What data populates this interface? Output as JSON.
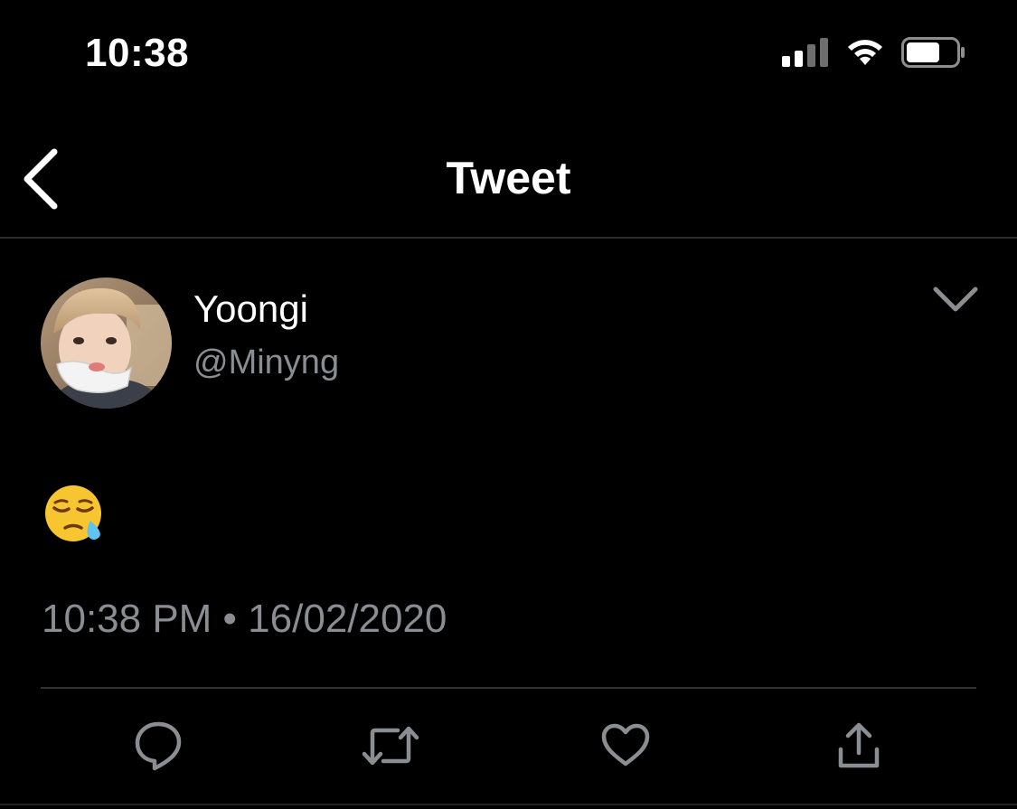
{
  "status_bar": {
    "time": "10:38",
    "icons": [
      "signal-icon",
      "wifi-icon",
      "battery-icon"
    ]
  },
  "nav": {
    "back_icon": "chevron-left-icon",
    "title": "Tweet"
  },
  "tweet": {
    "author_name": "Yoongi",
    "author_handle": "@Minyng",
    "body_emoji": "sleepy-face-emoji",
    "timestamp": "10:38 PM • 16/02/2020",
    "menu_icon": "chevron-down-icon"
  },
  "actions": [
    "reply-icon",
    "retweet-icon",
    "like-icon",
    "share-icon"
  ],
  "colors": {
    "background": "#000000",
    "text_primary": "#ffffff",
    "text_secondary": "#8a8d91",
    "icon_gray": "#8a8d91",
    "divider": "#2f3336",
    "emoji_face": "#f7c52f",
    "emoji_drop": "#5fc4f0"
  }
}
